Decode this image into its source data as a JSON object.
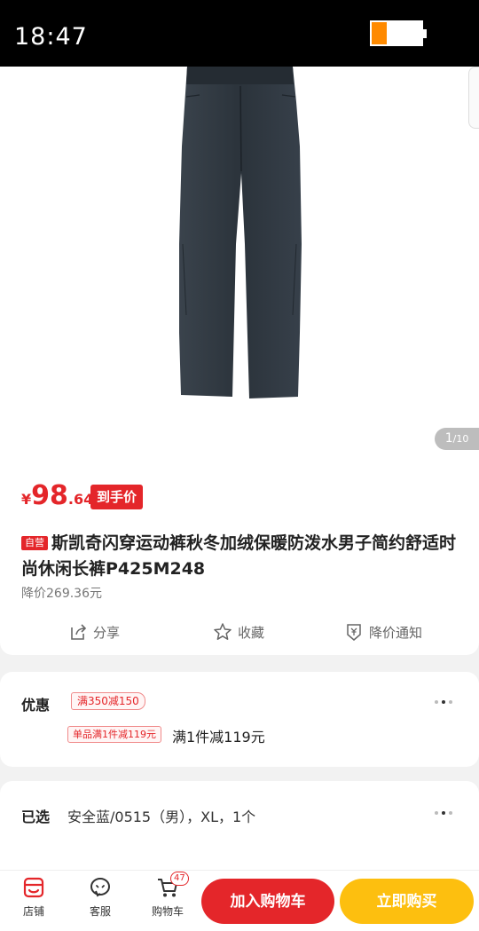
{
  "status_bar": {
    "time": "18:47",
    "battery_level": 0.3
  },
  "gallery": {
    "page_indicator": {
      "current": "1",
      "total": "/10"
    }
  },
  "price": {
    "currency": "¥",
    "integer": "98",
    "decimal": ".64",
    "tag": "到手价"
  },
  "product": {
    "badge": "自营",
    "title": "斯凯奇闪穿运动裤秋冬加绒保暖防泼水男子简约舒适时尚休闲长裤P425M248",
    "price_drop": "降价269.36元"
  },
  "actions": {
    "share": "分享",
    "favorite": "收藏",
    "notify": "降价通知"
  },
  "promo": {
    "label": "优惠",
    "coupon1": "满350减150",
    "coupon2": "单品满1件减119元",
    "coupon2_desc": "满1件减119元"
  },
  "selected": {
    "label": "已选",
    "value": "安全蓝/0515（男），XL，1个"
  },
  "bottom_bar": {
    "store": "店铺",
    "service": "客服",
    "cart": "购物车",
    "cart_count": "47",
    "add_to_cart": "加入购物车",
    "buy_now": "立即购买"
  },
  "colors": {
    "accent": "#e4262a",
    "buy": "#fdbf0f",
    "pants": "#2f3740"
  }
}
